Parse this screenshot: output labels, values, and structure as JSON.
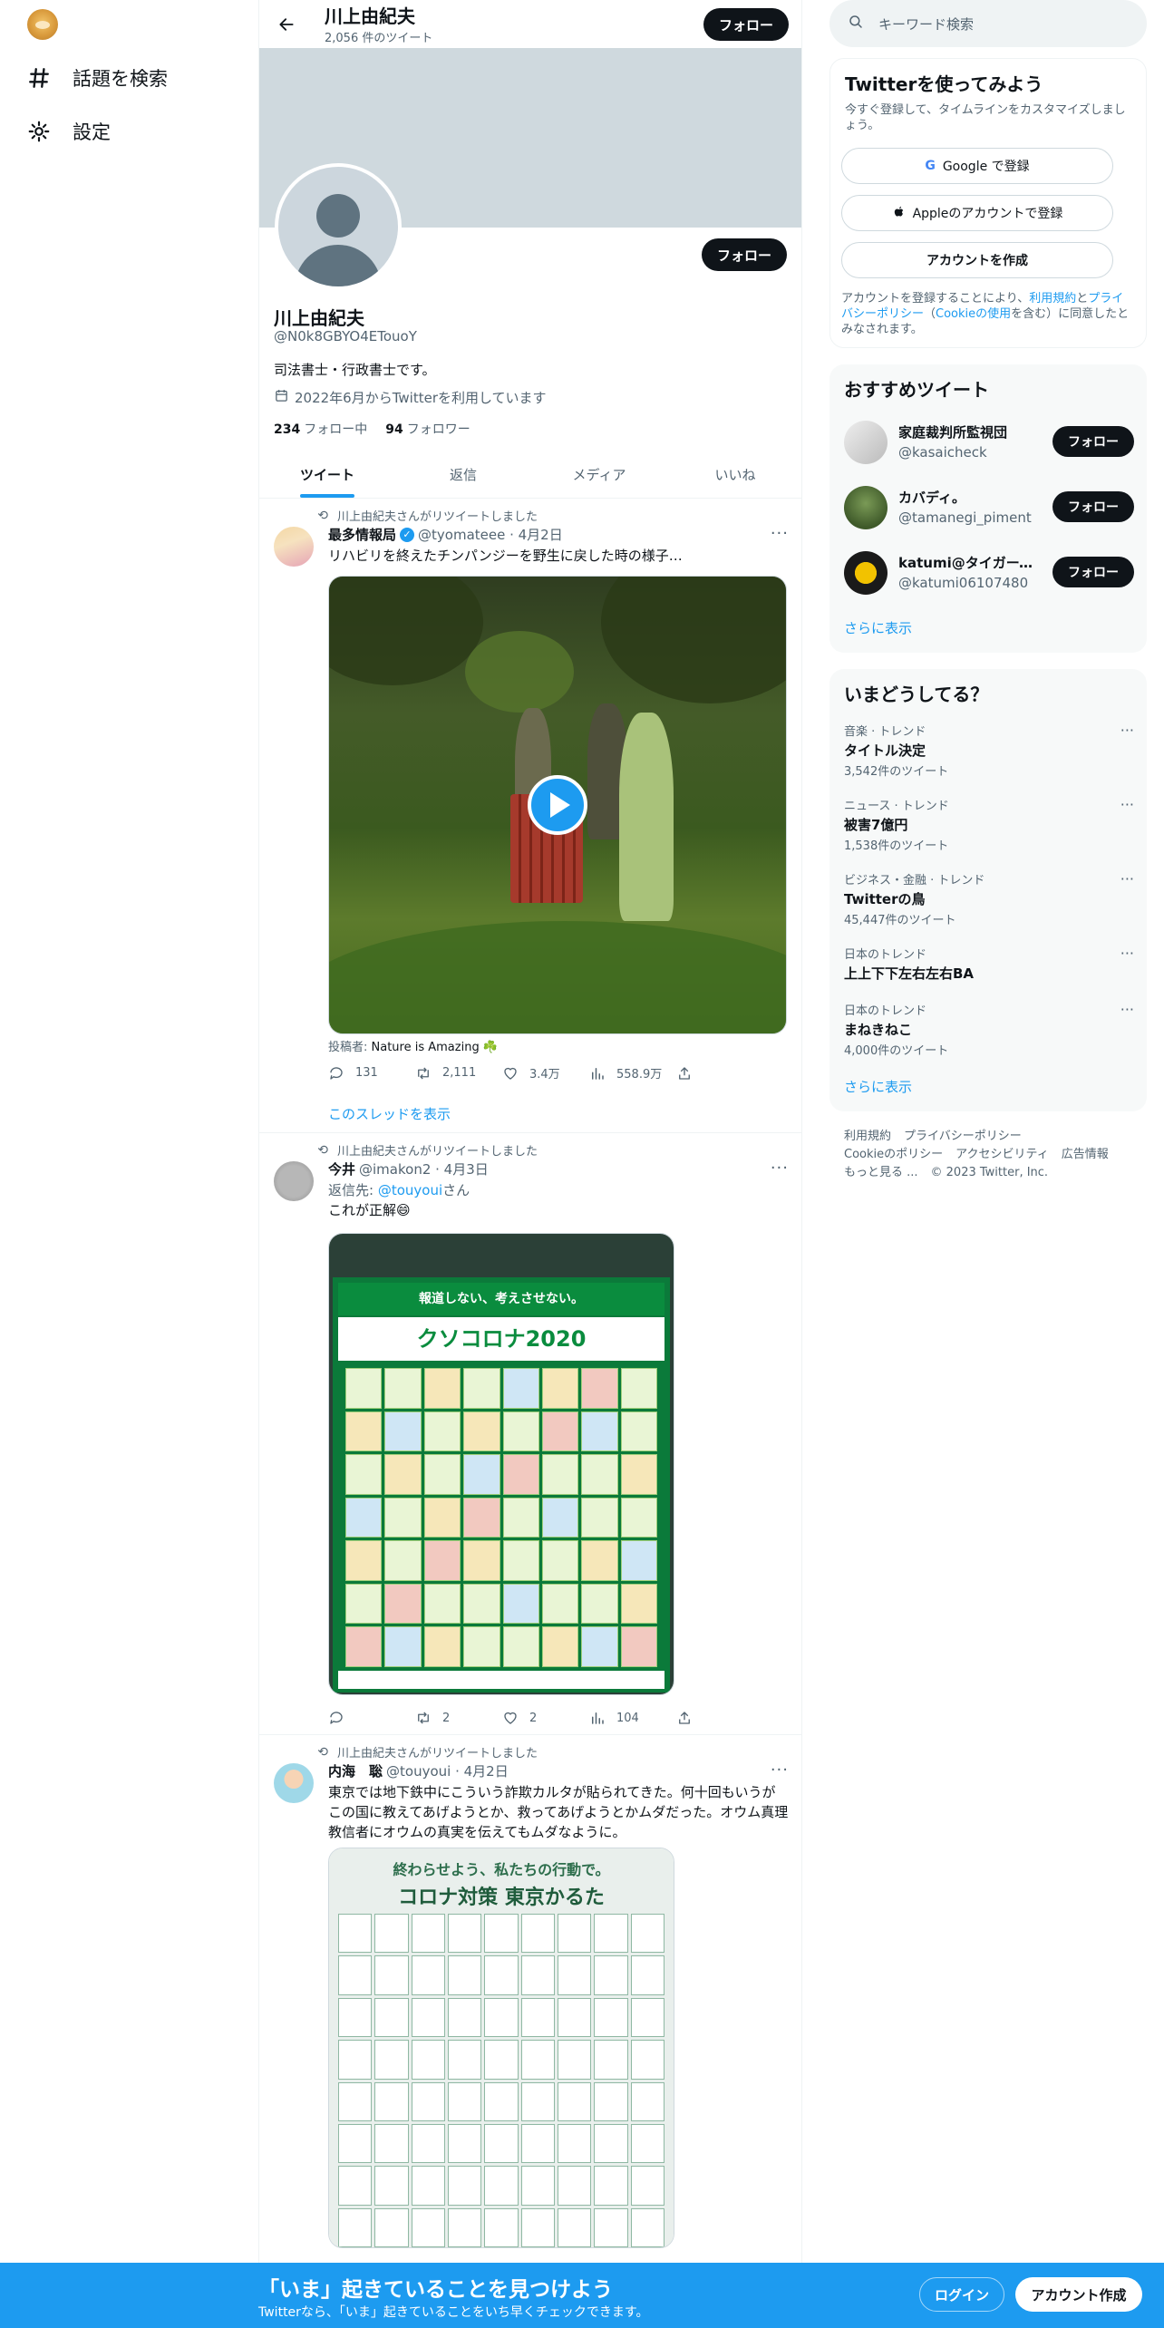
{
  "nav": {
    "explore_label": "話題を検索",
    "settings_label": "設定"
  },
  "header": {
    "name": "川上由紀夫",
    "tweet_count": "2,056 件のツイート",
    "follow_label": "フォロー"
  },
  "profile": {
    "name": "川上由紀夫",
    "handle": "@N0k8GBYO4ETouoY",
    "bio": "司法書士・行政書士です。",
    "joined": "2022年6月からTwitterを利用しています",
    "following_count": "234",
    "following_label": "フォロー中",
    "followers_count": "94",
    "followers_label": "フォロワー",
    "follow_label": "フォロー"
  },
  "tabs": [
    {
      "label": "ツイート"
    },
    {
      "label": "返信"
    },
    {
      "label": "メディア"
    },
    {
      "label": "いいね"
    }
  ],
  "tweets": [
    {
      "retweet_line": "川上由紀夫さんがリツイートしました",
      "name": "最多情報局",
      "handle_date": "@tyomateee · 4月2日",
      "text": "リハビリを終えたチンパンジーを野生に戻した時の様子…",
      "caption_prefix": "投稿者: ",
      "caption_source": "Nature is Amazing ☘️",
      "replies": "131",
      "retweets": "2,111",
      "likes": "3.4万",
      "views": "558.9万",
      "thread_link": "このスレッドを表示"
    },
    {
      "retweet_line": "川上由紀夫さんがリツイートしました",
      "name": "今井",
      "handle_date": "@imakon2 · 4月3日",
      "reply_prefix": "返信先: ",
      "reply_to": "@touyoui",
      "reply_suffix": "さん",
      "text": "これが正解😄",
      "poster_band": "報道しない、考えさせない。",
      "poster_title": "クソコロナ2020",
      "replies": "",
      "retweets": "2",
      "likes": "2",
      "views": "104"
    },
    {
      "retweet_line": "川上由紀夫さんがリツイートしました",
      "name": "内海　聡",
      "handle_date": "@touyoui · 4月2日",
      "text": "東京では地下鉄中にこういう詐欺カルタが貼られてきた。何十回もいうがこの国に教えてあげようとか、救ってあげようとかムダだった。オウム真理教信者にオウムの真実を伝えてもムダなように。",
      "poster_top": "終わらせよう、私たちの行動で。",
      "poster_title": "コロナ対策 東京かるた"
    }
  ],
  "sidebar": {
    "search_placeholder": "キーワード検索",
    "signup": {
      "title": "Twitterを使ってみよう",
      "subtitle": "今すぐ登録して、タイムラインをカスタマイズしましょう。",
      "google": "Google で登録",
      "apple": "Appleのアカウントで登録",
      "create": "アカウントを作成",
      "legal_1": "アカウントを登録することにより、",
      "legal_terms": "利用規約",
      "legal_2": "と",
      "legal_privacy": "プライバシーポリシー",
      "legal_3": "（",
      "legal_cookie": "Cookieの使用",
      "legal_4": "を含む）に同意したとみなされます。"
    },
    "recommend": {
      "title": "おすすめツイート",
      "follow_label": "フォロー",
      "more": "さらに表示",
      "users": [
        {
          "name": "家庭裁判所監視団",
          "handle": "@kasaicheck"
        },
        {
          "name": "カバディ。",
          "handle": "@tamanegi_piment"
        },
        {
          "name": "katumi@タイガース...",
          "handle": "@katumi06107480"
        }
      ]
    },
    "trends": {
      "title": "いまどうしてる？",
      "more": "さらに表示",
      "items": [
        {
          "context": "音楽 · トレンド",
          "name": "タイトル決定",
          "count": "3,542件のツイート"
        },
        {
          "context": "ニュース · トレンド",
          "name": "被害7億円",
          "count": "1,538件のツイート"
        },
        {
          "context": "ビジネス・金融 · トレンド",
          "name": "Twitterの鳥",
          "count": "45,447件のツイート"
        },
        {
          "context": "日本のトレンド",
          "name": "上上下下左右左右BA",
          "count": ""
        },
        {
          "context": "日本のトレンド",
          "name": "まねきねこ",
          "count": "4,000件のツイート"
        }
      ]
    },
    "footer": {
      "terms": "利用規約",
      "privacy": "プライバシーポリシー",
      "cookie": "Cookieのポリシー",
      "accessibility": "アクセシビリティ",
      "ads": "広告情報",
      "more": "もっと見る ...",
      "copyright": "© 2023 Twitter, Inc."
    }
  },
  "bottom_bar": {
    "title": "「いま」起きていることを見つけよう",
    "subtitle": "Twitterなら、「いま」起きていることをいち早くチェックできます。",
    "login": "ログイン",
    "signup": "アカウント作成"
  }
}
